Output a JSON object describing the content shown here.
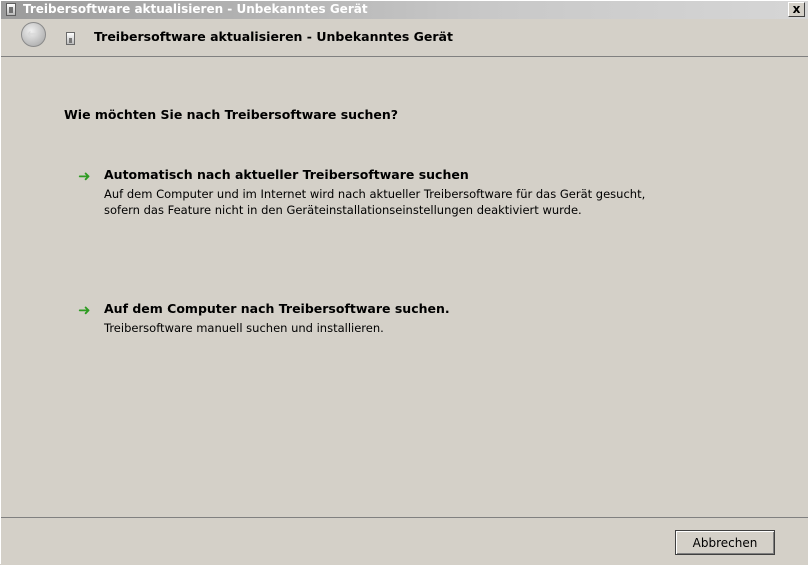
{
  "window": {
    "title": "Treibersoftware aktualisieren - Unbekanntes Gerät",
    "close_label": "x"
  },
  "header": {
    "back_arrow": "←",
    "title": "Treibersoftware aktualisieren - Unbekanntes Gerät"
  },
  "main": {
    "question": "Wie möchten Sie nach Treibersoftware suchen?",
    "options": [
      {
        "arrow": "➜",
        "title": "Automatisch nach aktueller Treibersoftware suchen",
        "description": "Auf dem Computer und im Internet wird nach aktueller Treibersoftware für das Gerät gesucht, sofern das Feature nicht in den Geräteinstallationseinstellungen deaktiviert wurde."
      },
      {
        "arrow": "➜",
        "title": "Auf dem Computer nach Treibersoftware suchen.",
        "description": "Treibersoftware manuell suchen und installieren."
      }
    ]
  },
  "footer": {
    "cancel_label": "Abbrechen"
  },
  "colors": {
    "window_background": "#d4d0c8",
    "arrow_green": "#2e9b22",
    "titlebar_text": "#ffffff"
  },
  "icons": {
    "titlebar": "device-icon",
    "back": "back-arrow-icon",
    "header": "device-icon",
    "option_arrow": "green-arrow-icon"
  }
}
